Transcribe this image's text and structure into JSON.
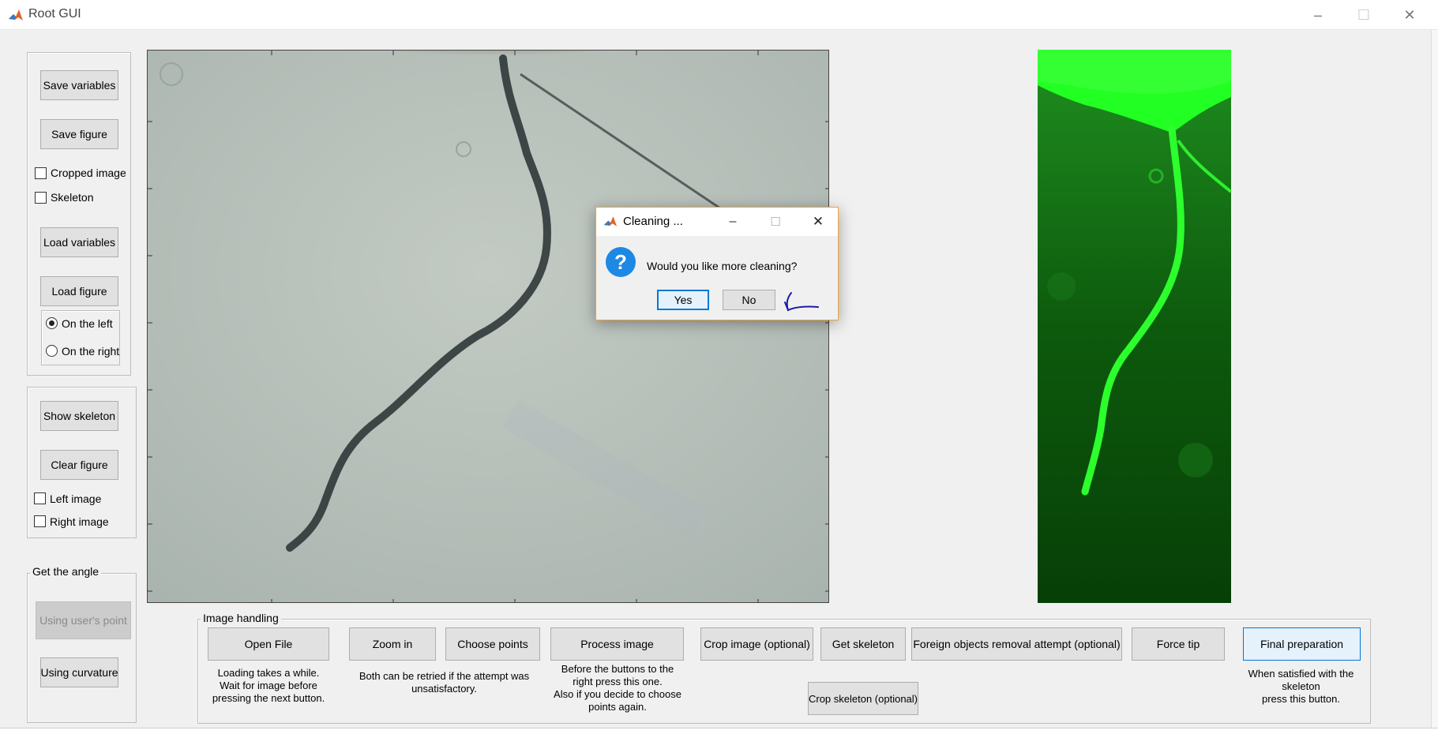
{
  "window": {
    "title": "Root GUI",
    "controls": {
      "minimize": "–",
      "maximize": "☐",
      "close": "✕"
    }
  },
  "left_panel": {
    "save_variables": "Save variables",
    "save_figure": "Save figure",
    "cropped_image": "Cropped image",
    "skeleton": "Skeleton",
    "load_variables": "Load variables",
    "load_figure": "Load figure",
    "on_the_left": "On the left",
    "on_the_right": "On the right"
  },
  "show_panel": {
    "show_skeleton": "Show skeleton",
    "clear_figure": "Clear figure",
    "left_image": "Left image",
    "right_image": "Right image"
  },
  "angle_panel": {
    "title": "Get the angle",
    "using_users_point": "Using user's point",
    "using_curvature": "Using curvature"
  },
  "image_handling": {
    "title": "Image handling",
    "open_file": "Open File",
    "open_file_note": [
      "Loading takes a while.",
      "Wait for  image before",
      "pressing the next button."
    ],
    "zoom_in": "Zoom in",
    "choose_points": "Choose points",
    "choose_note": [
      "Both can be retried if the attempt was",
      "unsatisfactory."
    ],
    "process_image": "Process image",
    "process_note": [
      "Before the buttons to the",
      "right press this one.",
      "Also if you decide to choose",
      "points again."
    ],
    "crop_image": "Crop image (optional)",
    "get_skeleton": "Get skeleton",
    "foreign_objects": "Foreign objects removal attempt (optional)",
    "force_tip": "Force tip",
    "final_preparation": "Final preparation",
    "final_note": [
      "When satisfied with the",
      "skeleton",
      "press this button."
    ],
    "crop_skeleton": "Crop skeleton (optional)"
  },
  "dialog": {
    "title": "Cleaning ...",
    "question": "Would you like more cleaning?",
    "yes": "Yes",
    "no": "No",
    "icon": "question-icon"
  },
  "colors": {
    "accent": "#0078d7",
    "dialog_border": "#e8a33d",
    "annotation": "#1a1aa8",
    "skeleton_green": "#33ff33"
  }
}
